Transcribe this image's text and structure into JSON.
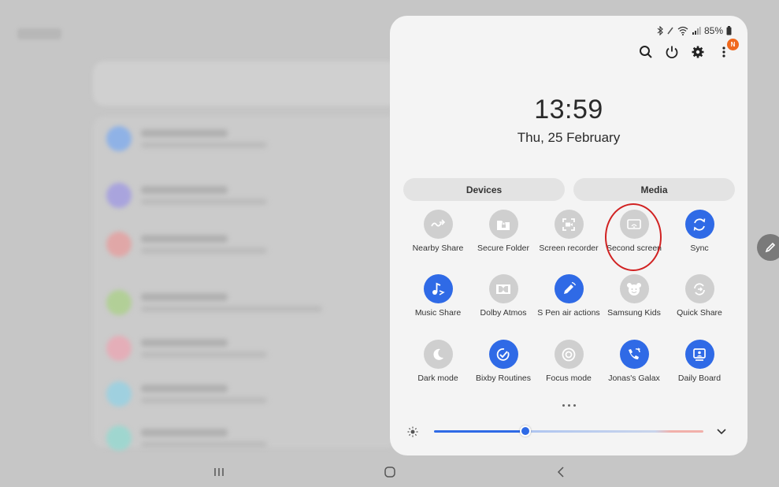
{
  "status_bar": {
    "battery": "85%"
  },
  "top_actions": [
    "search-icon",
    "power-icon",
    "gear-icon",
    "more-icon"
  ],
  "notification_badge": "N",
  "clock": {
    "time": "13:59",
    "date": "Thu, 25 February"
  },
  "tabs": [
    {
      "label": "Devices"
    },
    {
      "label": "Media"
    }
  ],
  "quick_tiles": [
    {
      "label": "Nearby Share",
      "icon": "nearby-share-icon",
      "active": false
    },
    {
      "label": "Secure Folder",
      "icon": "secure-folder-icon",
      "active": false
    },
    {
      "label": "Screen recorder",
      "icon": "screen-recorder-icon",
      "active": false
    },
    {
      "label": "Second screen",
      "icon": "second-screen-icon",
      "active": false
    },
    {
      "label": "Sync",
      "icon": "sync-icon",
      "active": true
    },
    {
      "label": "Music Share",
      "icon": "music-share-icon",
      "active": true
    },
    {
      "label": "Dolby Atmos",
      "icon": "dolby-atmos-icon",
      "active": false
    },
    {
      "label": "S Pen air actions",
      "icon": "s-pen-icon",
      "active": true
    },
    {
      "label": "Samsung Kids",
      "icon": "samsung-kids-icon",
      "active": false
    },
    {
      "label": "Quick Share",
      "icon": "quick-share-icon",
      "active": false
    },
    {
      "label": "Dark mode",
      "icon": "moon-icon",
      "active": false
    },
    {
      "label": "Bixby Routines",
      "icon": "bixby-routines-icon",
      "active": true
    },
    {
      "label": "Focus mode",
      "icon": "focus-mode-icon",
      "active": false
    },
    {
      "label": "Jonas's Galax",
      "icon": "phone-link-icon",
      "active": true
    },
    {
      "label": "Daily Board",
      "icon": "daily-board-icon",
      "active": true
    }
  ],
  "brightness": {
    "level": 0.34
  },
  "colors": {
    "accent": "#2f6ae6",
    "tile_off": "#cfcfcf",
    "highlight_ring": "#d12222",
    "badge": "#f0691e"
  }
}
